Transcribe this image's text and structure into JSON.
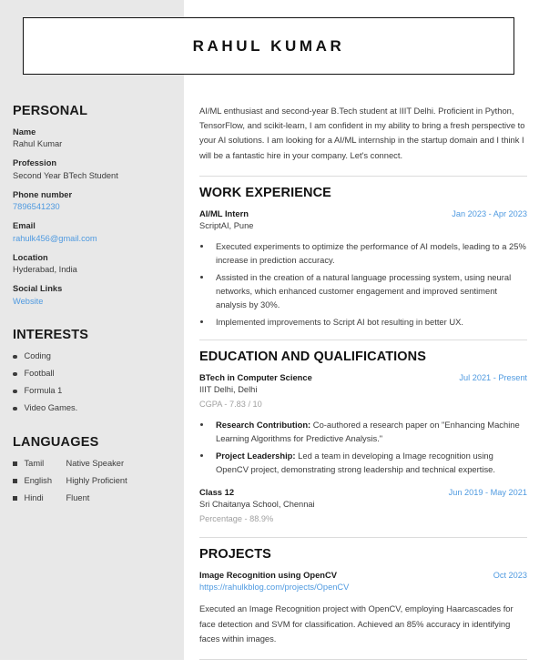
{
  "header": {
    "name": "RAHUL KUMAR"
  },
  "sidebar": {
    "personal": {
      "title": "PERSONAL",
      "fields": [
        {
          "label": "Name",
          "value": "Rahul Kumar",
          "is_link": false
        },
        {
          "label": "Profession",
          "value": "Second Year BTech Student",
          "is_link": false
        },
        {
          "label": "Phone number",
          "value": "7896541230",
          "is_link": true
        },
        {
          "label": "Email",
          "value": "rahulk456@gmail.com",
          "is_link": true
        },
        {
          "label": "Location",
          "value": "Hyderabad, India",
          "is_link": false
        },
        {
          "label": "Social Links",
          "value": "Website",
          "is_link": true
        }
      ]
    },
    "interests": {
      "title": "INTERESTS",
      "items": [
        "Coding",
        "Football",
        "Formula 1",
        "Video Games."
      ]
    },
    "languages": {
      "title": "LANGUAGES",
      "items": [
        {
          "name": "Tamil",
          "level": "Native Speaker"
        },
        {
          "name": "English",
          "level": "Highly Proficient"
        },
        {
          "name": "Hindi",
          "level": "Fluent"
        }
      ]
    }
  },
  "main": {
    "summary": "AI/ML enthusiast and second-year B.Tech student at IIIT Delhi. Proficient in Python, TensorFlow, and scikit-learn, I am confident in my ability to bring a fresh perspective to your AI solutions. I am looking for a AI/ML internship in the startup domain and I think I will be a fantastic hire in your company. Let's connect.",
    "work": {
      "title": "WORK EXPERIENCE",
      "entries": [
        {
          "role": "AI/ML Intern",
          "date": "Jan 2023 - Apr 2023",
          "company": "ScriptAI, Pune",
          "bullets": [
            {
              "lead": "",
              "text": "Executed experiments to optimize the performance of AI models, leading to a 25% increase in prediction accuracy."
            },
            {
              "lead": "",
              "text": "Assisted in the creation of a natural language processing system, using neural networks, which enhanced customer engagement and improved sentiment analysis by 30%."
            },
            {
              "lead": "",
              "text": "Implemented improvements to Script AI bot resulting in better UX."
            }
          ]
        }
      ]
    },
    "education": {
      "title": "EDUCATION AND QUALIFICATIONS",
      "entries": [
        {
          "degree": "BTech in Computer Science",
          "date": "Jul 2021 - Present",
          "institution": "IIIT Delhi, Delhi",
          "score": "CGPA - 7.83 / 10",
          "bullets": [
            {
              "lead": "Research Contribution:",
              "text": " Co-authored a research paper on \"Enhancing Machine Learning Algorithms for Predictive Analysis.\""
            },
            {
              "lead": "Project Leadership:",
              "text": " Led a team in developing a Image recognition using OpenCV project, demonstrating strong leadership and technical expertise."
            }
          ]
        },
        {
          "degree": "Class 12",
          "date": "Jun 2019 - May 2021",
          "institution": "Sri Chaitanya School, Chennai",
          "score": "Percentage - 88.9%",
          "bullets": []
        }
      ]
    },
    "projects": {
      "title": "PROJECTS",
      "entries": [
        {
          "name": "Image Recognition using OpenCV",
          "date": "Oct 2023",
          "url": "https://rahulkblog.com/projects/OpenCV",
          "description": "Executed an Image Recognition project with OpenCV, employing Haarcascades for face detection and SVM for classification. Achieved an 85% accuracy in identifying faces within images."
        }
      ]
    }
  },
  "colors": {
    "sidebar_bg": "#e8e8e8",
    "accent_link": "#4f9ae0",
    "text": "#3b3b3b",
    "heading": "#111111",
    "muted": "#a0a0a0",
    "rule": "#dcdcdc"
  }
}
